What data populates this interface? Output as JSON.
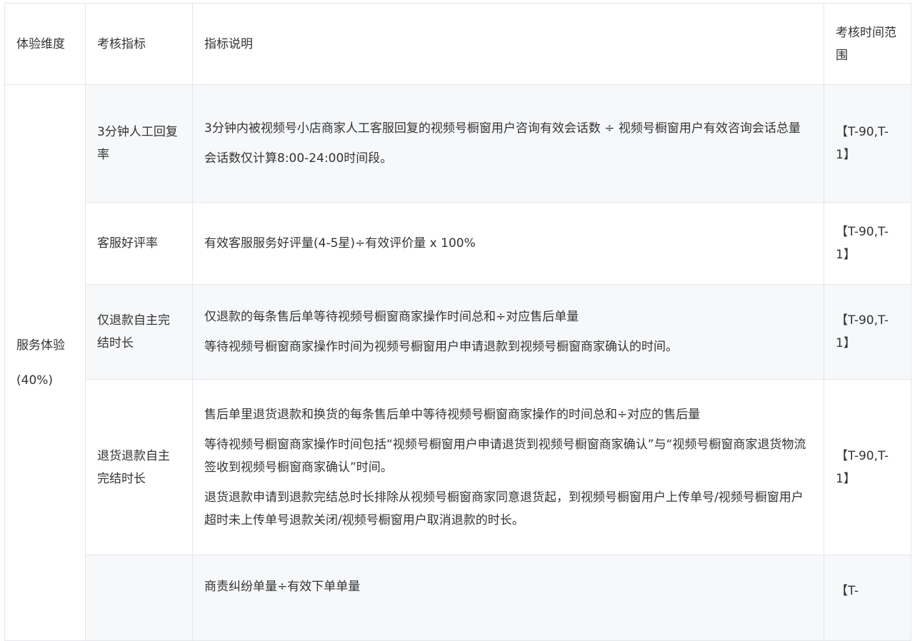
{
  "table": {
    "headers": {
      "dimension": "体验维度",
      "indicator": "考核指标",
      "description": "指标说明",
      "time_range": "考核时间范围"
    },
    "dimension": {
      "name": "服务体验",
      "weight": "(40%)"
    },
    "rows": [
      {
        "indicator": "3分钟人工回复率",
        "description": [
          "3分钟内被视频号小店商家人工客服回复的视频号橱窗用户咨询有效会话数 ÷ 视频号橱窗用户有效咨询会话总量",
          "会话数仅计算8:00-24:00时间段。"
        ],
        "time_range": "【T-90,T-1】"
      },
      {
        "indicator": "客服好评率",
        "description": [
          "有效客服服务好评量(4-5星)÷有效评价量 x 100%"
        ],
        "time_range": "【T-90,T-1】"
      },
      {
        "indicator": "仅退款自主完结时长",
        "description": [
          "仅退款的每条售后单等待视频号橱窗商家操作时间总和÷对应售后单量",
          "等待视频号橱窗商家操作时间为视频号橱窗用户申请退款到视频号橱窗商家确认的时间。"
        ],
        "time_range": "【T-90,T-1】"
      },
      {
        "indicator": "退货退款自主完结时长",
        "description": [
          "售后单里退货退款和换货的每条售后单中等待视频号橱窗商家操作的时间总和÷对应的售后量",
          "等待视频号橱窗商家操作时间包括“视频号橱窗用户申请退货到视频号橱窗商家确认”与“视频号橱窗商家退货物流签收到视频号橱窗商家确认”时间。",
          "退货退款申请到退款完结总时长排除从视频号橱窗商家同意退货起，到视频号橱窗用户上传单号/视频号橱窗用户超时未上传单号退款关闭/视频号橱窗用户取消退款的时长。"
        ],
        "time_range": "【T-90,T-1】"
      },
      {
        "indicator": "",
        "description": [
          "商责纠纷单量÷有效下单单量"
        ],
        "time_range": "【T-"
      }
    ]
  }
}
